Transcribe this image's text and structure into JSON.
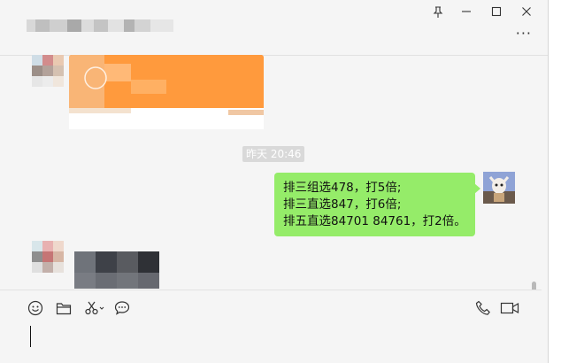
{
  "window": {
    "controls": {
      "pin_icon": "pin-icon",
      "minimize_icon": "minimize-icon",
      "maximize_icon": "maximize-icon",
      "close_icon": "close-icon"
    },
    "more_label": "···"
  },
  "messages": {
    "timestamp": "昨天 20:46",
    "sent": {
      "lines": [
        "排三组选478，打5倍;",
        "排三直选847，打6倍;",
        "排五直选84701 84761，打2倍。"
      ]
    }
  },
  "toolbar": {
    "left_tools": [
      "emoji-icon",
      "folder-icon",
      "scissors-icon",
      "chat-bubble-icon"
    ],
    "right_tools": [
      "phone-icon",
      "video-icon"
    ]
  },
  "colors": {
    "bubble_green": "#95ec69",
    "orange_card": "#ff9a3d",
    "background": "#f5f5f5"
  }
}
